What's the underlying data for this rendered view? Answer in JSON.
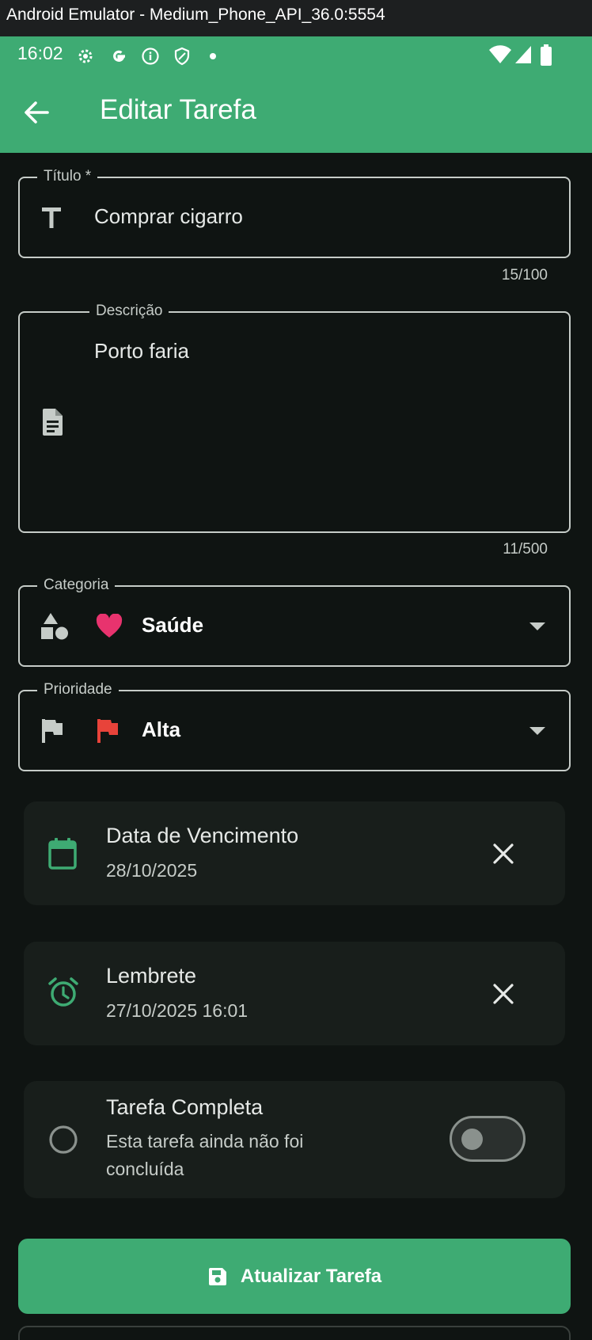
{
  "window": {
    "title": "Android Emulator - Medium_Phone_API_36.0:5554"
  },
  "status_bar": {
    "time": "16:02"
  },
  "app_bar": {
    "title": "Editar Tarefa"
  },
  "form": {
    "title_field": {
      "label": "Título *",
      "value": "Comprar cigarro",
      "counter": "15/100",
      "icon": "title-text-icon"
    },
    "description_field": {
      "label": "Descrição",
      "value": "Porto faria",
      "counter": "11/500",
      "icon": "document-icon"
    },
    "category_field": {
      "label": "Categoria",
      "value": "Saúde",
      "icon": "category-shapes-icon",
      "value_icon": "heart-icon",
      "value_color": "#e8336e"
    },
    "priority_field": {
      "label": "Prioridade",
      "value": "Alta",
      "icon": "flag-icon",
      "value_icon": "flag-icon",
      "value_color": "#e8433a"
    }
  },
  "due_date": {
    "title": "Data de Vencimento",
    "value": "28/10/2025",
    "icon": "calendar-icon"
  },
  "reminder": {
    "title": "Lembrete",
    "value": "27/10/2025 16:01",
    "icon": "alarm-icon"
  },
  "completion": {
    "title": "Tarefa Completa",
    "subtitle_line1": "Esta tarefa ainda não foi",
    "subtitle_line2": "concluída",
    "checked": false
  },
  "actions": {
    "update_label": "Atualizar Tarefa"
  },
  "colors": {
    "primary": "#3eab73",
    "background": "#0f1412",
    "surface": "#181e1b",
    "outline": "#c6ccc8"
  }
}
